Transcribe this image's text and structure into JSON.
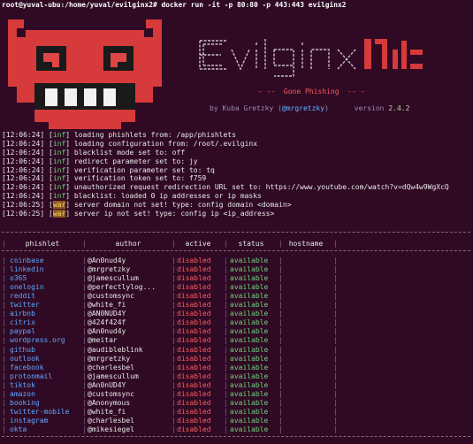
{
  "terminal": {
    "prompt": "root@yuval-ubu:/home/yuval/evilginx2# docker run -it -p 80:80 -p 443:443 evilginx2"
  },
  "banner": {
    "ascii_art": "evilginx",
    "tagline": "- --  Gone Phishing  -- -",
    "byline_prefix": "by Kuba Gretzky (",
    "byline_handle": "@mrgretzky",
    "byline_mid": ")      version ",
    "version": "2.4.2"
  },
  "log": [
    {
      "ts": "[12:06:24]",
      "level": "inf",
      "msg": "loading phishlets from: /app/phishlets"
    },
    {
      "ts": "[12:06:24]",
      "level": "inf",
      "msg": "loading configuration from: /root/.evilginx"
    },
    {
      "ts": "[12:06:24]",
      "level": "inf",
      "msg": "blacklist mode set to: off"
    },
    {
      "ts": "[12:06:24]",
      "level": "inf",
      "msg": "redirect parameter set to: jy"
    },
    {
      "ts": "[12:06:24]",
      "level": "inf",
      "msg": "verification parameter set to: tq"
    },
    {
      "ts": "[12:06:24]",
      "level": "inf",
      "msg": "verification token set to: f759"
    },
    {
      "ts": "[12:06:24]",
      "level": "inf",
      "msg": "unauthorized request redirection URL set to: https://www.youtube.com/watch?v=dQw4w9WgXcQ"
    },
    {
      "ts": "[12:06:24]",
      "level": "inf",
      "msg": "blacklist: loaded 0 ip addresses or ip masks"
    },
    {
      "ts": "[12:06:25]",
      "level": "war",
      "msg": "server domain not set! type: config domain <domain>"
    },
    {
      "ts": "[12:06:25]",
      "level": "war",
      "msg": "server ip not set! type: config ip <ip_address>"
    }
  ],
  "table": {
    "headers": [
      "phishlet",
      "author",
      "active",
      "status",
      "hostname"
    ],
    "rows": [
      {
        "phishlet": "coinbase",
        "author": "@An0nud4y",
        "active": "disabled",
        "status": "available",
        "hostname": ""
      },
      {
        "phishlet": "linkedin",
        "author": "@mrgretzky",
        "active": "disabled",
        "status": "available",
        "hostname": ""
      },
      {
        "phishlet": "o365",
        "author": "@jamescullum",
        "active": "disabled",
        "status": "available",
        "hostname": ""
      },
      {
        "phishlet": "onelogin",
        "author": "@perfectlylog...",
        "active": "disabled",
        "status": "available",
        "hostname": ""
      },
      {
        "phishlet": "reddit",
        "author": "@customsync",
        "active": "disabled",
        "status": "available",
        "hostname": ""
      },
      {
        "phishlet": "twitter",
        "author": "@white_fi",
        "active": "disabled",
        "status": "available",
        "hostname": ""
      },
      {
        "phishlet": "airbnb",
        "author": "@AN0NUD4Y",
        "active": "disabled",
        "status": "available",
        "hostname": ""
      },
      {
        "phishlet": "citrix",
        "author": "@424f424f",
        "active": "disabled",
        "status": "available",
        "hostname": ""
      },
      {
        "phishlet": "paypal",
        "author": "@An0nud4y",
        "active": "disabled",
        "status": "available",
        "hostname": ""
      },
      {
        "phishlet": "wordpress.org",
        "author": "@meitar",
        "active": "disabled",
        "status": "available",
        "hostname": ""
      },
      {
        "phishlet": "github",
        "author": "@audibleblink",
        "active": "disabled",
        "status": "available",
        "hostname": ""
      },
      {
        "phishlet": "outlook",
        "author": "@mrgretzky",
        "active": "disabled",
        "status": "available",
        "hostname": ""
      },
      {
        "phishlet": "facebook",
        "author": "@charlesbel",
        "active": "disabled",
        "status": "available",
        "hostname": ""
      },
      {
        "phishlet": "protonmail",
        "author": "@jamescullum",
        "active": "disabled",
        "status": "available",
        "hostname": ""
      },
      {
        "phishlet": "tiktok",
        "author": "@An0nUD4Y",
        "active": "disabled",
        "status": "available",
        "hostname": ""
      },
      {
        "phishlet": "amazon",
        "author": "@customsync",
        "active": "disabled",
        "status": "available",
        "hostname": ""
      },
      {
        "phishlet": "booking",
        "author": "@Anonymous",
        "active": "disabled",
        "status": "available",
        "hostname": ""
      },
      {
        "phishlet": "twitter-mobile",
        "author": "@white_fi",
        "active": "disabled",
        "status": "available",
        "hostname": ""
      },
      {
        "phishlet": "instagram",
        "author": "@charlesbel",
        "active": "disabled",
        "status": "available",
        "hostname": ""
      },
      {
        "phishlet": "okta",
        "author": "@mikesiegel",
        "active": "disabled",
        "status": "available",
        "hostname": ""
      }
    ]
  },
  "colors": {
    "background": "#300a24",
    "info": "#6fd37a",
    "warning": "#ffd56a",
    "disabled": "#ff5c5c",
    "phishlet": "#5fa8ff"
  }
}
